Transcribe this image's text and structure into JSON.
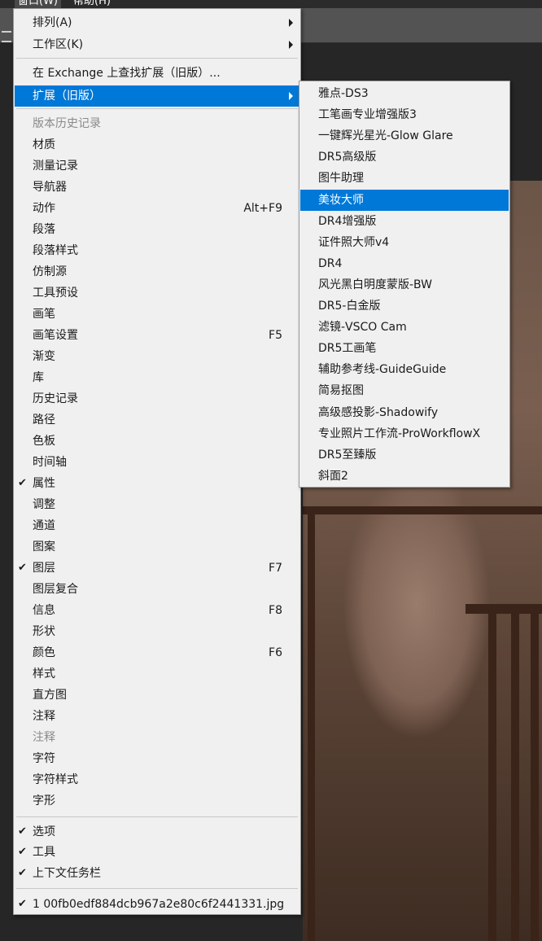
{
  "menubar": {
    "window_label": "窗口(W)",
    "help_label": "帮助(H)"
  },
  "window_menu": {
    "items": [
      {
        "label": "排列(A)",
        "submenu": true
      },
      {
        "label": "工作区(K)",
        "submenu": true
      },
      {
        "label": "在 Exchange 上查找扩展（旧版）...",
        "submenu": false
      },
      {
        "label": "扩展（旧版）",
        "submenu": true,
        "highlighted": true
      },
      {
        "label": "版本历史记录",
        "disabled": true
      },
      {
        "label": "材质"
      },
      {
        "label": "测量记录"
      },
      {
        "label": "导航器"
      },
      {
        "label": "动作",
        "shortcut": "Alt+F9"
      },
      {
        "label": "段落"
      },
      {
        "label": "段落样式"
      },
      {
        "label": "仿制源"
      },
      {
        "label": "工具预设"
      },
      {
        "label": "画笔"
      },
      {
        "label": "画笔设置",
        "shortcut": "F5"
      },
      {
        "label": "渐变"
      },
      {
        "label": "库"
      },
      {
        "label": "历史记录"
      },
      {
        "label": "路径"
      },
      {
        "label": "色板"
      },
      {
        "label": "时间轴"
      },
      {
        "label": "属性",
        "checked": true
      },
      {
        "label": "调整"
      },
      {
        "label": "通道"
      },
      {
        "label": "图案"
      },
      {
        "label": "图层",
        "checked": true,
        "shortcut": "F7"
      },
      {
        "label": "图层复合"
      },
      {
        "label": "信息",
        "shortcut": "F8"
      },
      {
        "label": "形状"
      },
      {
        "label": "颜色",
        "shortcut": "F6"
      },
      {
        "label": "样式"
      },
      {
        "label": "直方图"
      },
      {
        "label": "注释"
      },
      {
        "label": "注释",
        "disabled": true
      },
      {
        "label": "字符"
      },
      {
        "label": "字符样式"
      },
      {
        "label": "字形"
      },
      {
        "label": "选项",
        "checked": true
      },
      {
        "label": "工具",
        "checked": true
      },
      {
        "label": "上下文任务栏",
        "checked": true
      },
      {
        "label": "1 00fb0edf884dcb967a2e80c6f2441331.jpg",
        "checked": true
      }
    ],
    "check_glyph": "✔"
  },
  "extensions_submenu": {
    "items": [
      {
        "label": "雅点-DS3"
      },
      {
        "label": "工笔画专业增强版3"
      },
      {
        "label": "一键辉光星光-Glow Glare"
      },
      {
        "label": "DR5高级版"
      },
      {
        "label": "图牛助理"
      },
      {
        "label": "美妆大师",
        "highlighted": true
      },
      {
        "label": "DR4增强版"
      },
      {
        "label": "证件照大师v4"
      },
      {
        "label": "DR4"
      },
      {
        "label": "风光黑白明度蒙版-BW"
      },
      {
        "label": "DR5-白金版"
      },
      {
        "label": "滤镜-VSCO Cam"
      },
      {
        "label": "DR5工画笔"
      },
      {
        "label": "辅助参考线-GuideGuide"
      },
      {
        "label": "简易抠图"
      },
      {
        "label": "高级感投影-Shadowify"
      },
      {
        "label": "专业照片工作流-ProWorkflowX"
      },
      {
        "label": "DR5至臻版"
      },
      {
        "label": "斜面2"
      }
    ]
  },
  "colors": {
    "highlight": "#0078d7",
    "menu_bg": "#f0f0f0",
    "disabled_text": "#8a8a8a"
  }
}
